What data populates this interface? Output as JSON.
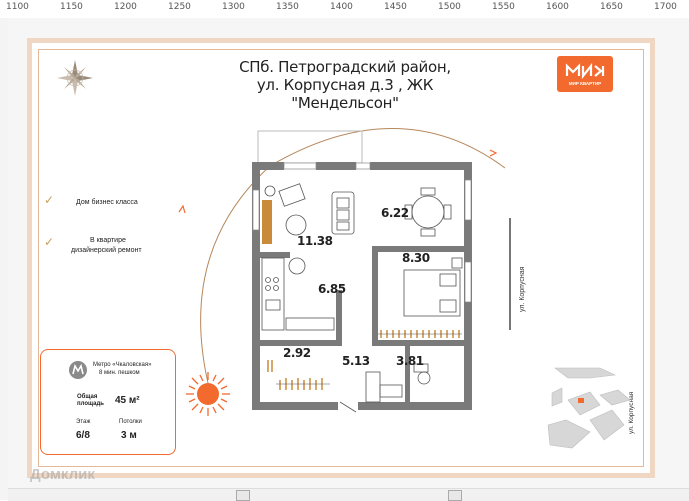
{
  "ruler": {
    "labels": [
      "1100",
      "1150",
      "1200",
      "1250",
      "1300",
      "1350",
      "1400",
      "1450",
      "1500",
      "1550",
      "1600",
      "1650",
      "1700"
    ]
  },
  "plan": {
    "title_line1": "СПб. Петроградский район,",
    "title_line2": "ул. Корпусная д.3 , ЖК \"Мендельсон\"",
    "logo_text": "МИР КВАРТИР",
    "features": [
      {
        "text": "Дом бизнес класса"
      },
      {
        "text_line1": "В квартире",
        "text_line2": "дизайнерский ремонт"
      }
    ],
    "info": {
      "metro_line1": "Метро «Чкаловская»",
      "metro_line2": "8 мин. пешком",
      "area_label_line1": "Общая",
      "area_label_line2": "площадь",
      "area_value": "45 м²",
      "floor_label": "Этаж",
      "floor_value": "6/8",
      "ceiling_label": "Потолки",
      "ceiling_value": "3 м"
    },
    "rooms": {
      "r1": "11.38",
      "r2": "6.22",
      "r3": "8.30",
      "r4": "6.85",
      "r5": "2.92",
      "r6": "5.13",
      "r7": "3.81"
    },
    "street_label": "ул. Корпусная",
    "street_label_map": "ул. Корпусная"
  },
  "watermark": "Домклик",
  "colors": {
    "accent": "#f26a2e",
    "frame": "#f0d7c4",
    "wall": "#7a7a7a"
  }
}
